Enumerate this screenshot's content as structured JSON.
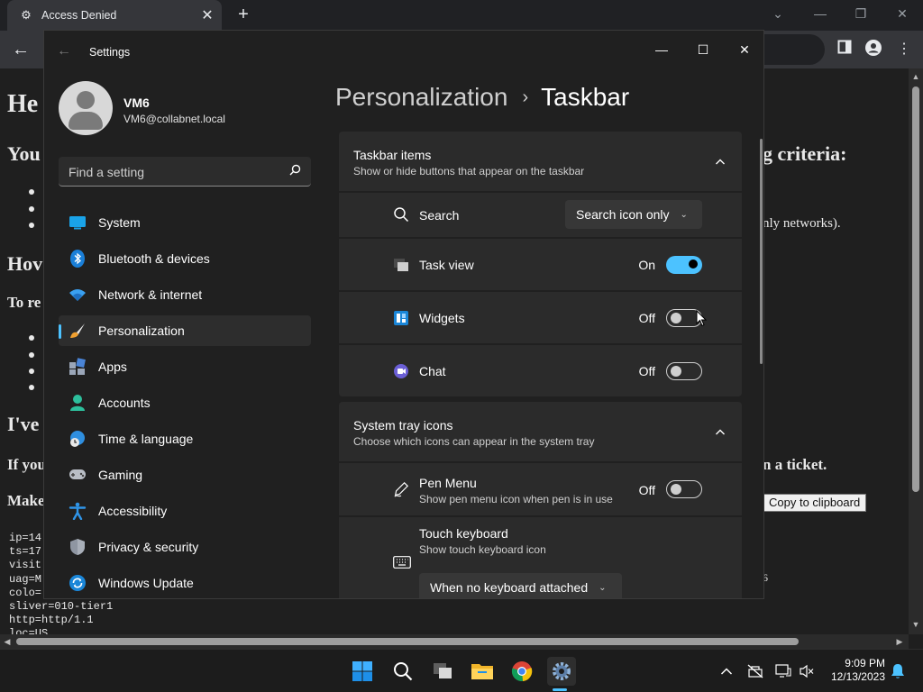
{
  "browser": {
    "tab_title": "Access Denied",
    "copy_button": "Copy to clipboard",
    "page": {
      "heading_fragment": "He",
      "line_you": "You",
      "line_criteria": "g criteria:",
      "line_networks": "nly networks).",
      "line_how": "Hov",
      "line_to": "To re",
      "line_ive": "I've",
      "line_if": "If you",
      "line_ticket": "n a ticket.",
      "line_make": "Make",
      "mono_lines": [
        "ip=14",
        "ts=17",
        "visit",
        "uag=M",
        "colo=",
        "sliver=010-tier1",
        "http=http/1.1",
        "loc=US"
      ],
      "fragment_6": "6"
    }
  },
  "settings": {
    "window_title": "Settings",
    "user_name": "VM6",
    "user_email": "VM6@collabnet.local",
    "search_placeholder": "Find a setting",
    "nav": [
      {
        "label": "System",
        "icon": "system-icon"
      },
      {
        "label": "Bluetooth & devices",
        "icon": "bluetooth-icon"
      },
      {
        "label": "Network & internet",
        "icon": "wifi-icon"
      },
      {
        "label": "Personalization",
        "icon": "brush-icon",
        "selected": true
      },
      {
        "label": "Apps",
        "icon": "apps-icon"
      },
      {
        "label": "Accounts",
        "icon": "accounts-icon"
      },
      {
        "label": "Time & language",
        "icon": "globe-clock-icon"
      },
      {
        "label": "Gaming",
        "icon": "gamepad-icon"
      },
      {
        "label": "Accessibility",
        "icon": "accessibility-icon"
      },
      {
        "label": "Privacy & security",
        "icon": "shield-icon"
      },
      {
        "label": "Windows Update",
        "icon": "update-icon"
      }
    ],
    "breadcrumb": {
      "parent": "Personalization",
      "current": "Taskbar"
    },
    "taskbar_items": {
      "title": "Taskbar items",
      "subtitle": "Show or hide buttons that appear on the taskbar",
      "search": {
        "label": "Search",
        "value": "Search icon only"
      },
      "task_view": {
        "label": "Task view",
        "state": "On"
      },
      "widgets": {
        "label": "Widgets",
        "state": "Off"
      },
      "chat": {
        "label": "Chat",
        "state": "Off"
      }
    },
    "system_tray": {
      "title": "System tray icons",
      "subtitle": "Choose which icons can appear in the system tray",
      "pen_menu": {
        "label": "Pen Menu",
        "sub": "Show pen menu icon when pen is in use",
        "state": "Off"
      },
      "touch_keyboard": {
        "label": "Touch keyboard",
        "sub": "Show touch keyboard icon",
        "value": "When no keyboard attached"
      }
    },
    "accent_color": "#4cc2ff"
  },
  "taskbar": {
    "apps": [
      "start-icon",
      "search-icon",
      "task-view-icon",
      "file-explorer-icon",
      "chrome-icon",
      "settings-icon"
    ],
    "time": "9:09 PM",
    "date": "12/13/2023"
  }
}
